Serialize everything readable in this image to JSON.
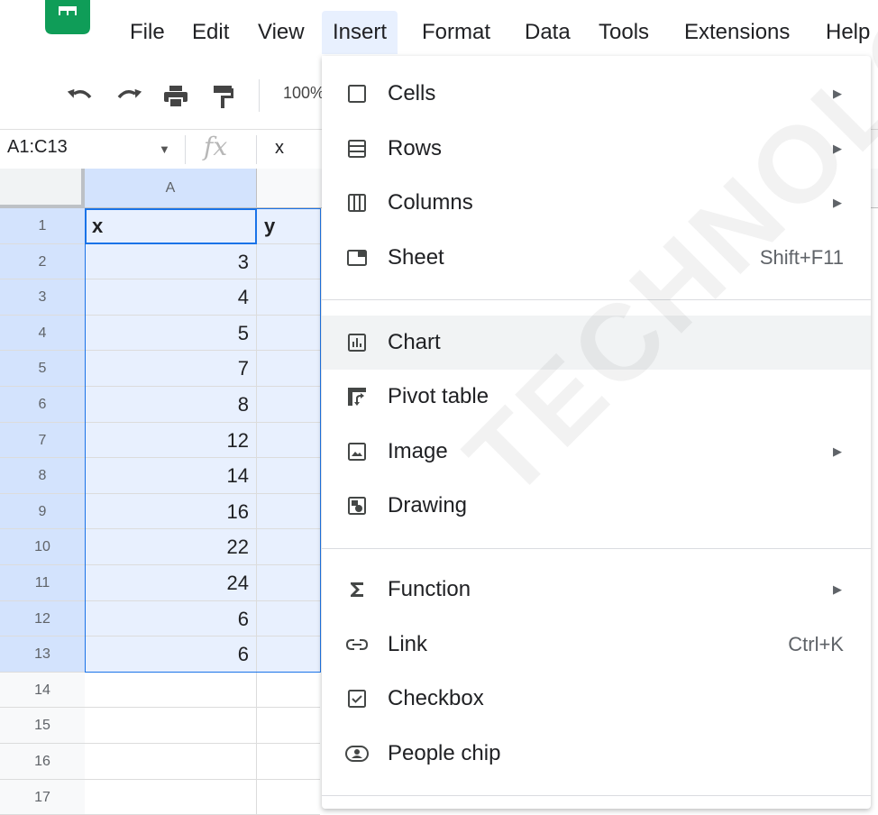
{
  "menubar": {
    "items": [
      "File",
      "Edit",
      "View",
      "Insert",
      "Format",
      "Data",
      "Tools",
      "Extensions",
      "Help"
    ]
  },
  "toolbar": {
    "zoom": "100%",
    "icons": [
      "undo-icon",
      "redo-icon",
      "print-icon",
      "paint-format-icon"
    ]
  },
  "formula_bar": {
    "name_box": "A1:C13",
    "fx_label": "fx",
    "value": "x"
  },
  "grid": {
    "columns": [
      "A"
    ],
    "rows": [
      {
        "n": "1",
        "a": "x",
        "b": "y",
        "header": true,
        "selected": true
      },
      {
        "n": "2",
        "a": "3",
        "b": "",
        "selected": true
      },
      {
        "n": "3",
        "a": "4",
        "b": "",
        "selected": true
      },
      {
        "n": "4",
        "a": "5",
        "b": "",
        "selected": true
      },
      {
        "n": "5",
        "a": "7",
        "b": "",
        "selected": true
      },
      {
        "n": "6",
        "a": "8",
        "b": "",
        "selected": true
      },
      {
        "n": "7",
        "a": "12",
        "b": "",
        "selected": true
      },
      {
        "n": "8",
        "a": "14",
        "b": "",
        "selected": true
      },
      {
        "n": "9",
        "a": "16",
        "b": "",
        "selected": true
      },
      {
        "n": "10",
        "a": "22",
        "b": "",
        "selected": true
      },
      {
        "n": "11",
        "a": "24",
        "b": "",
        "selected": true
      },
      {
        "n": "12",
        "a": "6",
        "b": "",
        "selected": true
      },
      {
        "n": "13",
        "a": "6",
        "b": "",
        "selected": true
      },
      {
        "n": "14",
        "a": "",
        "b": "",
        "selected": false
      },
      {
        "n": "15",
        "a": "",
        "b": "",
        "selected": false
      },
      {
        "n": "16",
        "a": "",
        "b": "",
        "selected": false
      },
      {
        "n": "17",
        "a": "",
        "b": "",
        "selected": false
      }
    ]
  },
  "insert_menu": {
    "items": [
      {
        "id": "cells",
        "label": "Cells",
        "icon": "cells-icon",
        "submenu": true,
        "shortcut": ""
      },
      {
        "id": "rows",
        "label": "Rows",
        "icon": "rows-icon",
        "submenu": true,
        "shortcut": ""
      },
      {
        "id": "columns",
        "label": "Columns",
        "icon": "columns-icon",
        "submenu": true,
        "shortcut": ""
      },
      {
        "id": "sheet",
        "label": "Sheet",
        "icon": "sheet-icon",
        "submenu": false,
        "shortcut": "Shift+F11"
      },
      {
        "id": "chart",
        "label": "Chart",
        "icon": "chart-icon",
        "submenu": false,
        "shortcut": "",
        "highlighted": true
      },
      {
        "id": "pivot-table",
        "label": "Pivot table",
        "icon": "pivot-table-icon",
        "submenu": false,
        "shortcut": ""
      },
      {
        "id": "image",
        "label": "Image",
        "icon": "image-icon",
        "submenu": true,
        "shortcut": ""
      },
      {
        "id": "drawing",
        "label": "Drawing",
        "icon": "drawing-icon",
        "submenu": false,
        "shortcut": ""
      },
      {
        "id": "function",
        "label": "Function",
        "icon": "sigma-icon",
        "submenu": true,
        "shortcut": ""
      },
      {
        "id": "link",
        "label": "Link",
        "icon": "link-icon",
        "submenu": false,
        "shortcut": "Ctrl+K"
      },
      {
        "id": "checkbox",
        "label": "Checkbox",
        "icon": "checkbox-icon",
        "submenu": false,
        "shortcut": ""
      },
      {
        "id": "people-chip",
        "label": "People chip",
        "icon": "people-chip-icon",
        "submenu": false,
        "shortcut": ""
      }
    ]
  },
  "watermark": "TECHNOLOGY",
  "colors": {
    "selection_fill": "#e8f0fe",
    "selection_border": "#1a73e8",
    "menu_highlight": "#f1f3f4",
    "sheets_green": "#0f9d58"
  }
}
